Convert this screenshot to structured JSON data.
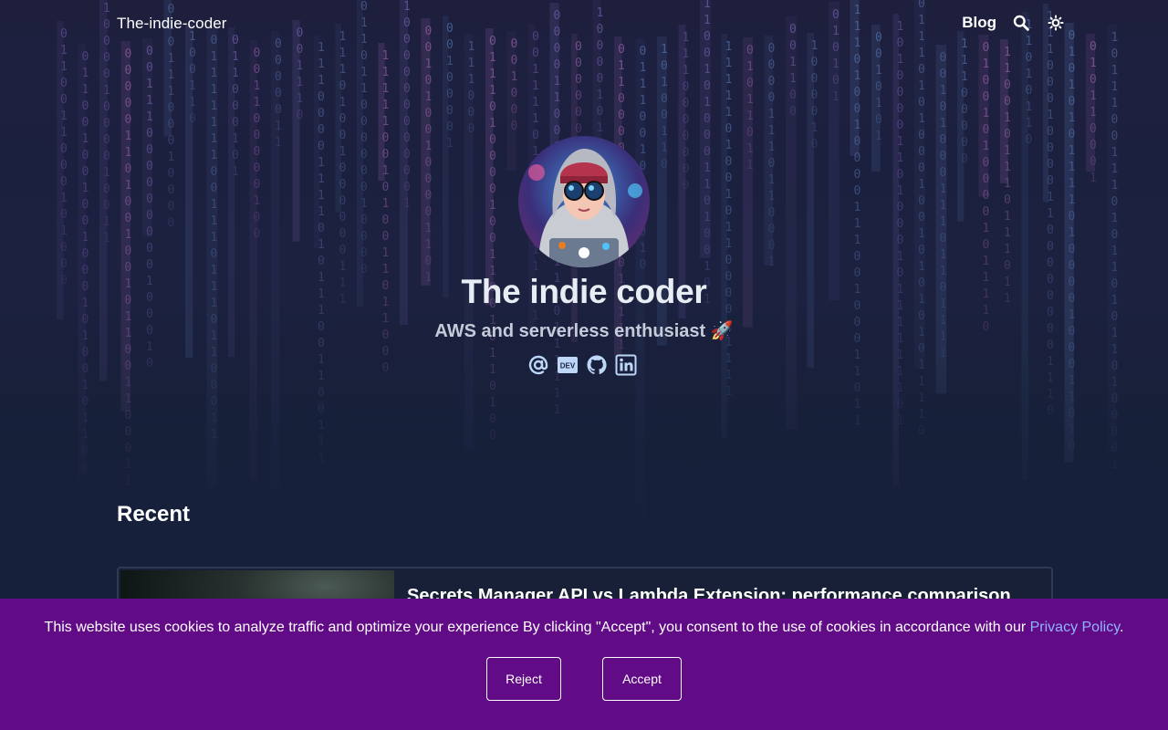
{
  "header": {
    "brand": "The-indie-coder",
    "nav_blog": "Blog",
    "search_icon": "search-icon",
    "theme_icon": "sun-icon"
  },
  "hero": {
    "avatar": "avatar-illustration",
    "title": "The indie coder",
    "subtitle": "AWS and serverless enthusiast 🚀",
    "socials": [
      {
        "icon": "at-email-icon"
      },
      {
        "icon": "dev-to-icon",
        "label": "DEV"
      },
      {
        "icon": "github-icon"
      },
      {
        "icon": "linkedin-icon"
      }
    ],
    "background": "binary-matrix-rain"
  },
  "recent": {
    "heading": "Recent",
    "posts": [
      {
        "title": "Secrets Manager API vs Lambda Extension: performance comparison"
      }
    ]
  },
  "cookie_banner": {
    "text": "This website uses cookies to analyze traffic and optimize your experience By clicking \"Accept\", you consent to the use of cookies in accordance with our ",
    "link": "Privacy Policy",
    "suffix": ".",
    "reject": "Reject",
    "accept": "Accept"
  },
  "colors": {
    "background": "#16203a",
    "cookie_banner": "#620b87",
    "link": "#8fb4ff"
  }
}
